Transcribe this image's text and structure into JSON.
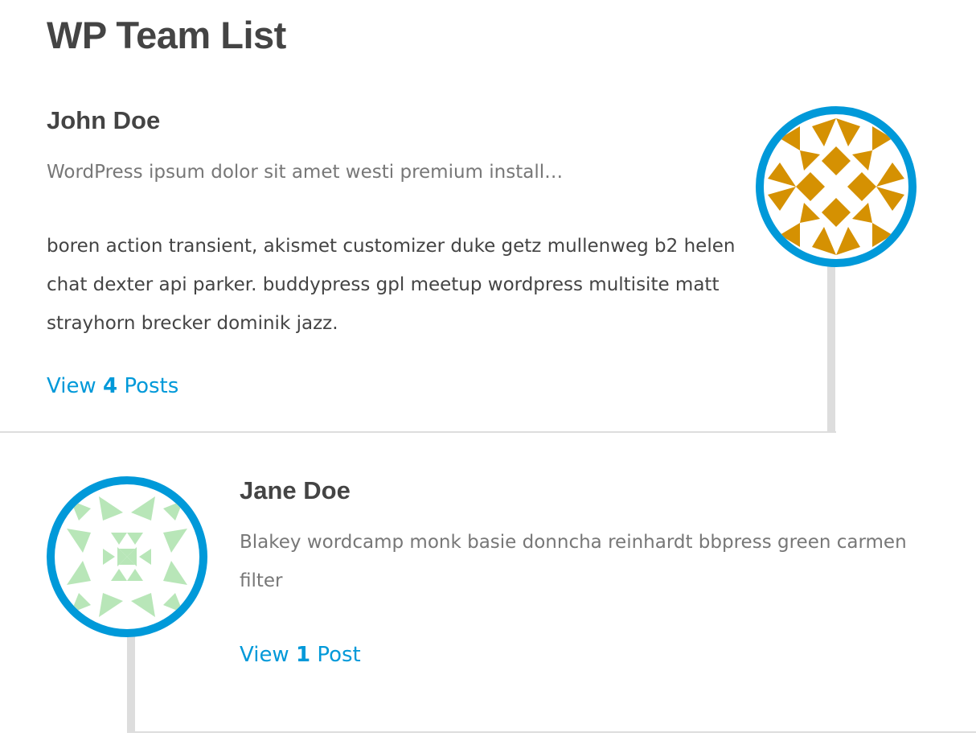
{
  "page": {
    "title": "WP Team List"
  },
  "members": [
    {
      "name": "John Doe",
      "intro": "WordPress ipsum dolor sit amet westi premium install…",
      "bio": "boren action transient, akismet customizer duke getz mullenweg b2 helen chat dexter api parker. buddypress gpl meetup wordpress multisite matt strayhorn brecker dominik jazz.",
      "link": {
        "prefix": "View",
        "count": "4",
        "suffix": "Posts"
      },
      "avatar_icon": "identicon-avatar-icon",
      "avatar_color": "#d59102"
    },
    {
      "name": "Jane Doe",
      "intro": "Blakey wordcamp monk basie donncha reinhardt bbpress green carmen filter",
      "link": {
        "prefix": "View",
        "count": "1",
        "suffix": "Post"
      },
      "avatar_icon": "identicon-avatar-icon",
      "avatar_color": "#b8e6b8"
    }
  ],
  "colors": {
    "accent": "#0099d9",
    "text": "#444444",
    "muted_text": "#777777",
    "divider": "#dddddd"
  }
}
